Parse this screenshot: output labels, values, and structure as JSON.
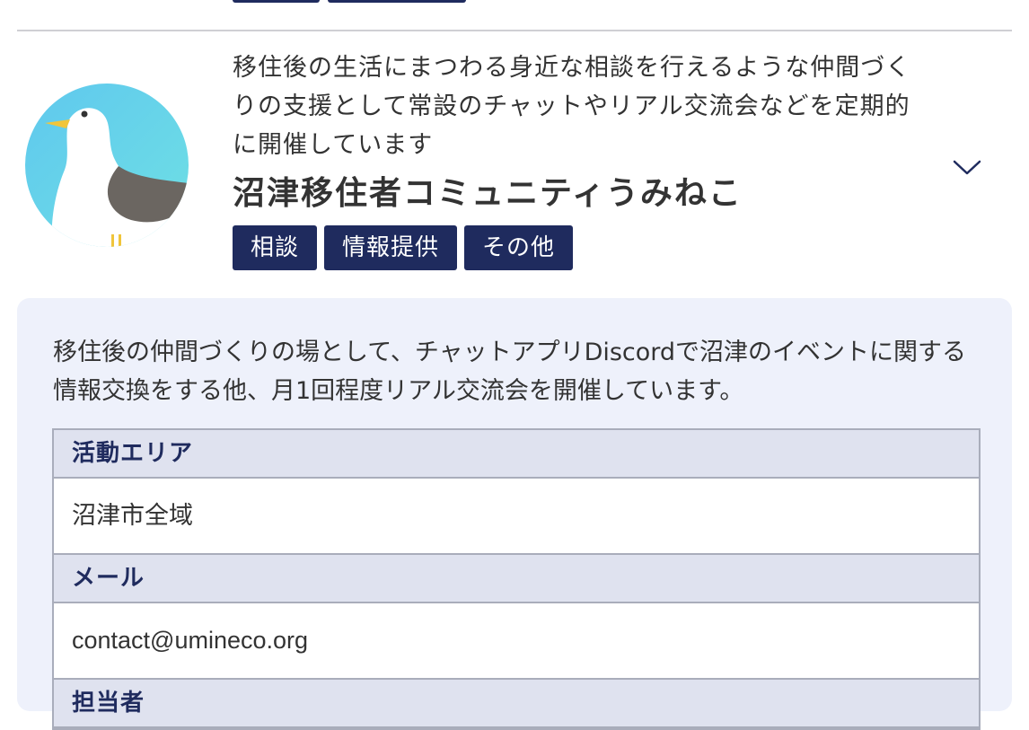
{
  "community": {
    "summary": "移住後の生活にまつわる身近な相談を行えるような仲間づくりの支援として常設のチャットやリアル交流会などを定期的に開催しています",
    "name": "沼津移住者コミュニティうみねこ",
    "tags": [
      "相談",
      "情報提供",
      "その他"
    ],
    "avatar_icon": "seagull-logo-icon",
    "expand_icon": "chevron-down-icon",
    "description": "移住後の仲間づくりの場として、チャットアプリDiscordで沼津のイベントに関する情報交換をする他、月1回程度リアル交流会を開催しています。",
    "details": [
      {
        "label": "活動エリア",
        "value": "沼津市全域"
      },
      {
        "label": "メール",
        "value": "contact@umineco.org"
      },
      {
        "label": "担当者",
        "value": ""
      }
    ]
  },
  "colors": {
    "tag_bg": "#1f2b5e",
    "panel_bg": "#eef1fb",
    "header_cell_bg": "#dfe2ef"
  }
}
